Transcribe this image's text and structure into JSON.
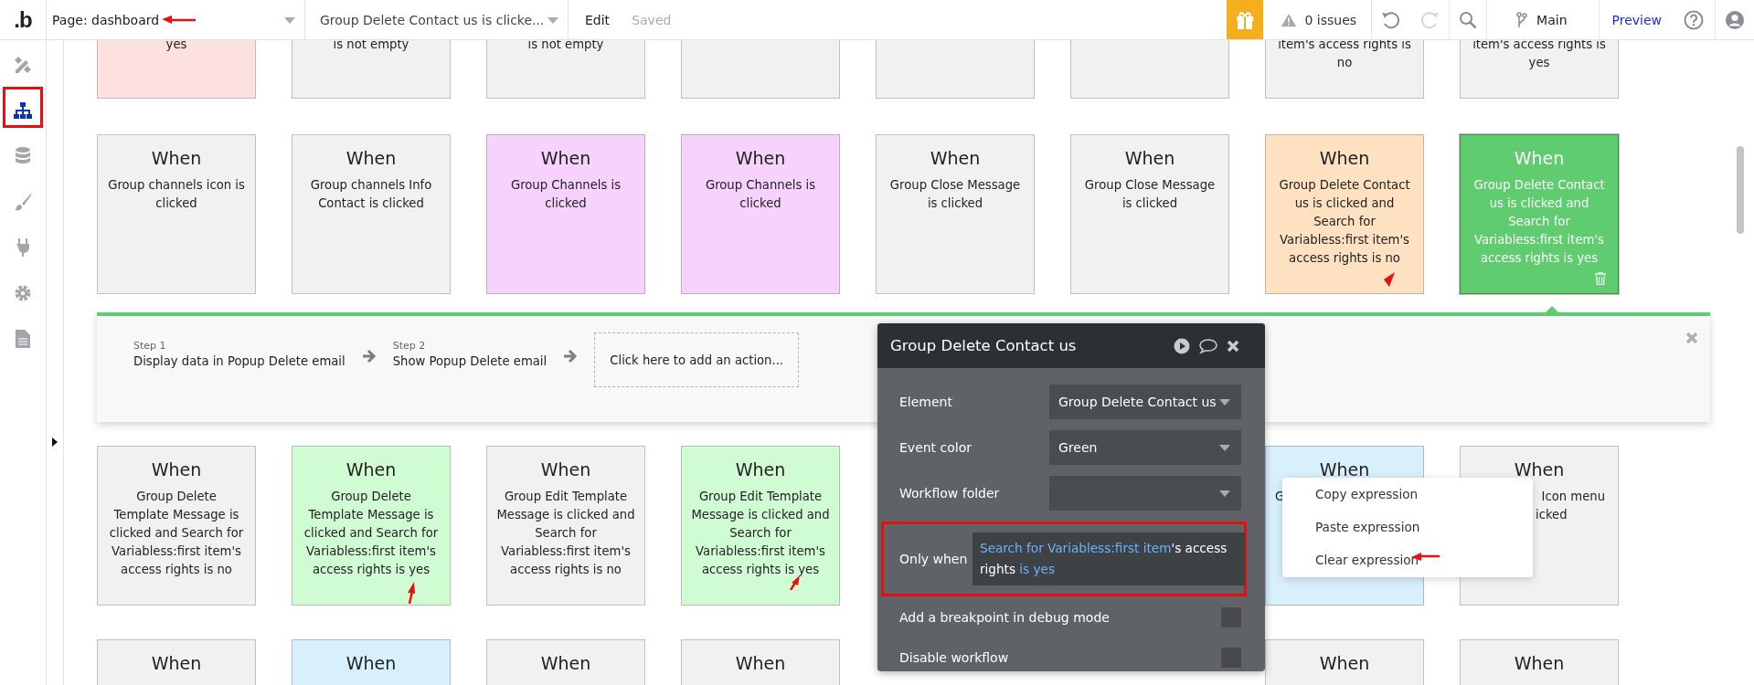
{
  "topbar": {
    "logo": ".b",
    "page": "Page: dashboard",
    "workflow": "Group Delete Contact us is clicke...",
    "edit": "Edit",
    "saved": "Saved",
    "issues": "0 issues",
    "branch": "Main",
    "preview": "Preview"
  },
  "sidebar": [
    {
      "kind": "design",
      "selected": false
    },
    {
      "kind": "workflow",
      "selected": true
    },
    {
      "kind": "data",
      "selected": false
    },
    {
      "kind": "styles",
      "selected": false
    },
    {
      "kind": "plugins",
      "selected": false
    },
    {
      "kind": "settings",
      "selected": false
    },
    {
      "kind": "logs",
      "selected": false
    }
  ],
  "rows": [
    {
      "cards": [
        {
          "lines": [
            "yes"
          ],
          "color": "#fde1e1",
          "selected": false
        },
        {
          "lines": [
            "is not empty"
          ],
          "color": "#f0f2f2",
          "selected": false
        },
        {
          "lines": [
            "is not empty"
          ],
          "color": "#f0f2f2",
          "selected": false
        },
        {
          "color": "#f0f2f2",
          "selected": false
        },
        {
          "color": "#f0f2f2",
          "selected": false
        },
        {
          "color": "#f0f2f2",
          "selected": false
        },
        {
          "lines": [
            "item's access rights is",
            "no"
          ],
          "color": "#f0f2f2",
          "selected": false
        },
        {
          "lines": [
            "item's access rights is",
            "yes"
          ],
          "color": "#f0f2f2",
          "selected": false
        }
      ]
    },
    {
      "cards": [
        {
          "title": "When",
          "lines": [
            "Group channels icon is",
            "clicked"
          ],
          "color": "#f0f2f2",
          "selected": false
        },
        {
          "title": "When",
          "lines": [
            "Group channels Info",
            "Contact is clicked"
          ],
          "color": "#f0f2f2",
          "selected": false
        },
        {
          "title": "When",
          "lines": [
            "Group Channels is",
            "clicked"
          ],
          "color": "#f6d2fc",
          "selected": false
        },
        {
          "title": "When",
          "lines": [
            "Group Channels is",
            "clicked"
          ],
          "color": "#f6d2fc",
          "selected": false
        },
        {
          "title": "When",
          "lines": [
            "Group Close Message",
            "is clicked"
          ],
          "color": "#f0f2f2",
          "selected": false
        },
        {
          "title": "When",
          "lines": [
            "Group Close Message",
            "is clicked"
          ],
          "color": "#f0f2f2",
          "selected": false
        },
        {
          "title": "When",
          "lines": [
            "Group Delete Contact",
            "us is clicked and",
            "Search for",
            "Variabless:first item's",
            "access rights is no"
          ],
          "color": "#fde1c0",
          "selected": false
        },
        {
          "title": "When",
          "lines": [
            "Group Delete Contact",
            "us is clicked and",
            "Search for",
            "Variabless:first item's",
            "access rights is yes"
          ],
          "color": "#5fcd6f",
          "selected": true
        }
      ]
    },
    {
      "cards": [
        {
          "title": "When",
          "lines": [
            "Group Delete",
            "Template Message is",
            "clicked and Search for",
            "Variabless:first item's",
            "access rights is no"
          ],
          "color": "#f0f2f2",
          "selected": false
        },
        {
          "title": "When",
          "lines": [
            "Group Delete",
            "Template Message is",
            "clicked and Search for",
            "Variabless:first item's",
            "access rights is yes"
          ],
          "color": "#d0fcd4",
          "selected": false
        },
        {
          "title": "When",
          "lines": [
            "Group Edit Template",
            "Message is clicked and",
            "Search for",
            "Variabless:first item's",
            "access rights is no"
          ],
          "color": "#f0f2f2",
          "selected": false
        },
        {
          "title": "When",
          "lines": [
            "Group Edit Template",
            "Message is clicked and",
            "Search for",
            "Variabless:first item's",
            "access rights is yes"
          ],
          "color": "#d0fcd4",
          "selected": false
        }
      ],
      "cards_right": [
        {
          "title": "When",
          "lines": [
            "G"
          ],
          "color": "#d8effc",
          "selected": false
        },
        {
          "title": "When",
          "lines": [
            "Icon menu",
            "icked"
          ],
          "color": "#f0f2f2",
          "selected": false
        }
      ]
    },
    {
      "cards": [
        {
          "title": "When",
          "color": "#f0f2f2",
          "selected": false
        },
        {
          "title": "When",
          "color": "#d8effc",
          "selected": false
        },
        {
          "title": "When",
          "color": "#f0f2f2",
          "selected": false
        },
        {
          "title": "When",
          "color": "#f0f2f2",
          "selected": false
        }
      ],
      "cards_right": [
        {
          "title": "When",
          "color": "#f0f2f2",
          "selected": false
        },
        {
          "title": "When",
          "color": "#f0f2f2",
          "selected": false
        }
      ]
    }
  ],
  "workflow_panel": {
    "steps": [
      {
        "label": "Step 1",
        "action": "Display data in Popup Delete email"
      },
      {
        "label": "Step 2",
        "action": "Show Popup Delete email"
      }
    ],
    "add_action": "Click here to add an action..."
  },
  "event_popup": {
    "title": "Group Delete Contact us",
    "fields": [
      {
        "label": "Element",
        "value": "Group Delete Contact us"
      },
      {
        "label": "Event color",
        "value": "Green"
      },
      {
        "label": "Workflow folder"
      }
    ],
    "only_when": {
      "label": "Only when",
      "expression": [
        {
          "kind": "dynamic",
          "text": "Search for Variabless:first item"
        },
        {
          "kind": "plain",
          "text": "'s access rights "
        },
        {
          "kind": "dynamic",
          "text": "is yes"
        }
      ]
    },
    "toggles": [
      {
        "label": "Add a breakpoint in debug mode",
        "checked": false
      },
      {
        "label": "Disable workflow",
        "checked": false
      }
    ]
  },
  "context_menu": [
    "Copy expression",
    "Paste expression",
    "Clear expression"
  ]
}
